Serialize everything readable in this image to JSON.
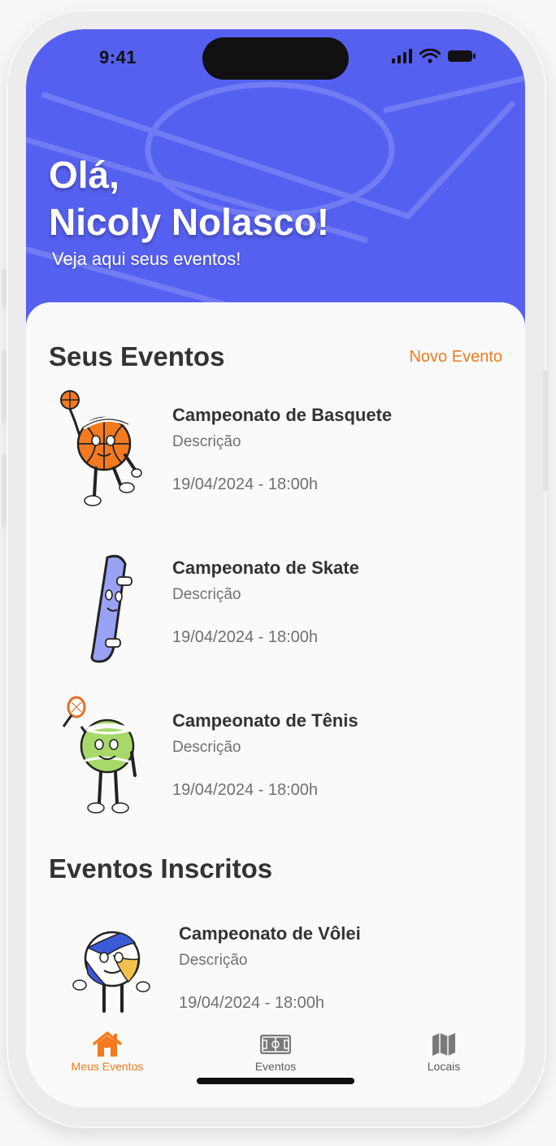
{
  "status": {
    "time": "9:41"
  },
  "header": {
    "greeting": "Olá,",
    "user_name": "Nicoly Nolasco!",
    "subtitle": "Veja aqui seus eventos!"
  },
  "my_events": {
    "title": "Seus Eventos",
    "new_event_label": "Novo Evento",
    "items": [
      {
        "title": "Campeonato de Basquete",
        "description": "Descrição",
        "datetime": "19/04/2024 - 18:00h",
        "icon": "basketball-mascot-icon"
      },
      {
        "title": "Campeonato de Skate",
        "description": "Descrição",
        "datetime": "19/04/2024 - 18:00h",
        "icon": "skateboard-mascot-icon"
      },
      {
        "title": "Campeonato de Tênis",
        "description": "Descrição",
        "datetime": "19/04/2024 - 18:00h",
        "icon": "tennis-ball-mascot-icon"
      }
    ]
  },
  "subscribed_events": {
    "title": "Eventos Inscritos",
    "items": [
      {
        "title": "Campeonato de Vôlei",
        "description": "Descrição",
        "datetime": "19/04/2024 - 18:00h",
        "icon": "volleyball-mascot-icon"
      }
    ]
  },
  "nav": {
    "items": [
      {
        "label": "Meus Eventos",
        "icon": "home-icon",
        "active": true
      },
      {
        "label": "Eventos",
        "icon": "field-icon",
        "active": false
      },
      {
        "label": "Locais",
        "icon": "map-icon",
        "active": false
      }
    ]
  },
  "colors": {
    "primary": "#5660f0",
    "accent": "#f47a1f",
    "inactive": "#6b6b6b"
  }
}
